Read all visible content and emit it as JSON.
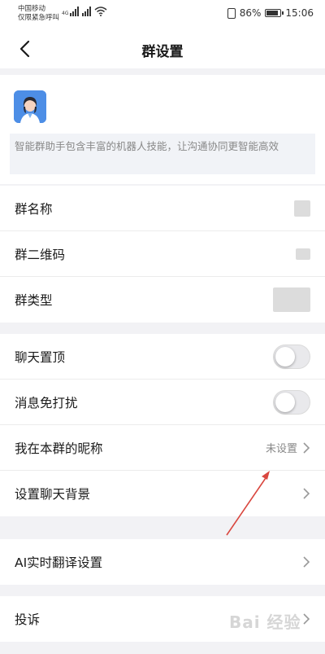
{
  "status_bar": {
    "carrier_line1": "中国移动",
    "carrier_line2": "仅限紧急呼叫",
    "net_tag": "4G",
    "battery": "86%",
    "time": "15:06"
  },
  "nav": {
    "title": "群设置"
  },
  "bot": {
    "description": "智能群助手包含丰富的机器人技能，让沟通协同更智能高效"
  },
  "group_info": [
    {
      "label": "群名称"
    },
    {
      "label": "群二维码"
    },
    {
      "label": "群类型"
    }
  ],
  "switches": [
    {
      "label": "聊天置顶",
      "on": false
    },
    {
      "label": "消息免打扰",
      "on": false
    }
  ],
  "nickname": {
    "label": "我在本群的昵称",
    "value": "未设置"
  },
  "background": {
    "label": "设置聊天背景"
  },
  "translate": {
    "label": "AI实时翻译设置"
  },
  "report": {
    "label": "投诉"
  },
  "watermark": "Bai 经验",
  "colors": {
    "annotation_arrow": "#d9473f",
    "avatar_bg": "#4d8ee6"
  },
  "icons": [
    "chevron-left-icon",
    "chevron-right-icon",
    "signal-icon",
    "wifi-icon",
    "vibrate-icon",
    "battery-icon"
  ]
}
